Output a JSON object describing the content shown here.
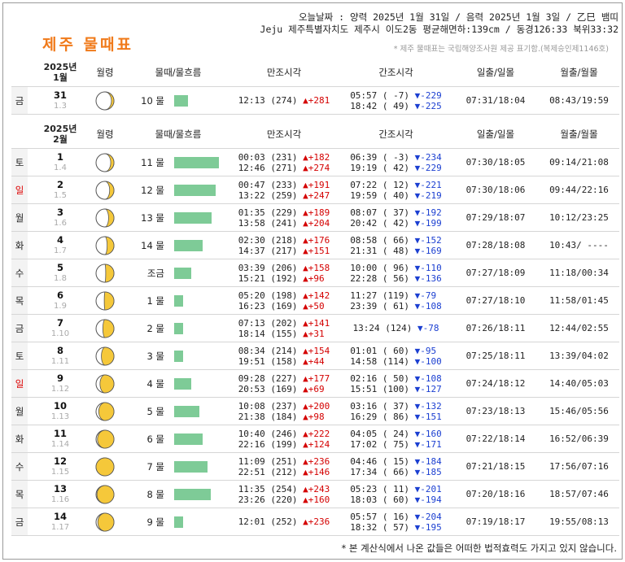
{
  "header": {
    "today_line": "오늘날짜 : 양력 2025년 1월 31일 / 음력 2025년 1월 3일 / 乙巳 뱀띠",
    "location_line": "Jeju 제주특별자치도 제주시 이도2동 평균해면하:139cm / 동경126:33 북위33:32",
    "title": "제주 물때표",
    "note": "* 제주 물때표는 국립해양조사원 제공 표기함.(복제승인제1146호)"
  },
  "columns": [
    "월령",
    "물때/물흐름",
    "만조시각",
    "간조시각",
    "일출/일몰",
    "월출/월몰"
  ],
  "jan": {
    "label_year": "2025년",
    "label_month": "1월",
    "rows": [
      {
        "wd": "금",
        "sun": false,
        "day": "31",
        "lunar": "1.3",
        "phase": 0.14,
        "mul": "10 물",
        "flow": 0.3,
        "h1": "12:13 (274)",
        "h1d": "▲+281",
        "h2": "",
        "h2d": "",
        "l1": "05:57 ( -7)",
        "l1d": "▼-229",
        "l2": "18:42 ( 49)",
        "l2d": "▼-225",
        "sun_rs": "07:31/18:04",
        "moon_rs": "08:43/19:59"
      }
    ]
  },
  "feb": {
    "label_year": "2025년",
    "label_month": "2월",
    "rows": [
      {
        "wd": "토",
        "sun": false,
        "day": "1",
        "lunar": "1.4",
        "phase": 0.18,
        "mul": "11 물",
        "flow": 1.0,
        "h1": "00:03 (231)",
        "h1d": "▲+182",
        "h2": "12:46 (271)",
        "h2d": "▲+274",
        "l1": "06:39 ( -3)",
        "l1d": "▼-234",
        "l2": "19:19 ( 42)",
        "l2d": "▼-229",
        "sun_rs": "07:30/18:05",
        "moon_rs": "09:14/21:08"
      },
      {
        "wd": "일",
        "sun": true,
        "day": "2",
        "lunar": "1.5",
        "phase": 0.24,
        "mul": "12 물",
        "flow": 0.92,
        "h1": "00:47 (233)",
        "h1d": "▲+191",
        "h2": "13:22 (259)",
        "h2d": "▲+247",
        "l1": "07:22 ( 12)",
        "l1d": "▼-221",
        "l2": "19:59 ( 40)",
        "l2d": "▼-219",
        "sun_rs": "07:30/18:06",
        "moon_rs": "09:44/22:16"
      },
      {
        "wd": "월",
        "sun": false,
        "day": "3",
        "lunar": "1.6",
        "phase": 0.3,
        "mul": "13 물",
        "flow": 0.84,
        "h1": "01:35 (229)",
        "h1d": "▲+189",
        "h2": "13:58 (241)",
        "h2d": "▲+204",
        "l1": "08:07 ( 37)",
        "l1d": "▼-192",
        "l2": "20:42 ( 42)",
        "l2d": "▼-199",
        "sun_rs": "07:29/18:07",
        "moon_rs": "10:12/23:25"
      },
      {
        "wd": "화",
        "sun": false,
        "day": "4",
        "lunar": "1.7",
        "phase": 0.38,
        "mul": "14 물",
        "flow": 0.64,
        "h1": "02:30 (218)",
        "h1d": "▲+176",
        "h2": "14:37 (217)",
        "h2d": "▲+151",
        "l1": "08:58 ( 66)",
        "l1d": "▼-152",
        "l2": "21:31 ( 48)",
        "l2d": "▼-169",
        "sun_rs": "07:28/18:08",
        "moon_rs": "10:43/ ----"
      },
      {
        "wd": "수",
        "sun": false,
        "day": "5",
        "lunar": "1.8",
        "phase": 0.46,
        "mul": "조금",
        "flow": 0.38,
        "h1": "03:39 (206)",
        "h1d": "▲+158",
        "h2": "15:21 (192)",
        "h2d": "▲+96",
        "l1": "10:00 ( 96)",
        "l1d": "▼-110",
        "l2": "22:28 ( 56)",
        "l2d": "▼-136",
        "sun_rs": "07:27/18:09",
        "moon_rs": "11:18/00:34"
      },
      {
        "wd": "목",
        "sun": false,
        "day": "6",
        "lunar": "1.9",
        "phase": 0.54,
        "mul": "1 물",
        "flow": 0.2,
        "h1": "05:20 (198)",
        "h1d": "▲+142",
        "h2": "16:23 (169)",
        "h2d": "▲+50",
        "l1": "11:27 (119)",
        "l1d": "▼-79",
        "l2": "23:39 ( 61)",
        "l2d": "▼-108",
        "sun_rs": "07:27/18:10",
        "moon_rs": "11:58/01:45"
      },
      {
        "wd": "금",
        "sun": false,
        "day": "7",
        "lunar": "1.10",
        "phase": 0.62,
        "mul": "2 물",
        "flow": 0.2,
        "h1": "07:13 (202)",
        "h1d": "▲+141",
        "h2": "18:14 (155)",
        "h2d": "▲+31",
        "l1": "13:24 (124)",
        "l1d": "▼-78",
        "l2": "",
        "l2d": "",
        "sun_rs": "07:26/18:11",
        "moon_rs": "12:44/02:55"
      },
      {
        "wd": "토",
        "sun": false,
        "day": "8",
        "lunar": "1.11",
        "phase": 0.7,
        "mul": "3 물",
        "flow": 0.2,
        "h1": "08:34 (214)",
        "h1d": "▲+154",
        "h2": "19:51 (158)",
        "h2d": "▲+44",
        "l1": "01:01 ( 60)",
        "l1d": "▼-95",
        "l2": "14:58 (114)",
        "l2d": "▼-100",
        "sun_rs": "07:25/18:11",
        "moon_rs": "13:39/04:02"
      },
      {
        "wd": "일",
        "sun": true,
        "day": "9",
        "lunar": "1.12",
        "phase": 0.78,
        "mul": "4 물",
        "flow": 0.38,
        "h1": "09:28 (227)",
        "h1d": "▲+177",
        "h2": "20:53 (169)",
        "h2d": "▲+69",
        "l1": "02:16 ( 50)",
        "l1d": "▼-108",
        "l2": "15:51 (100)",
        "l2d": "▼-127",
        "sun_rs": "07:24/18:12",
        "moon_rs": "14:40/05:03"
      },
      {
        "wd": "월",
        "sun": false,
        "day": "10",
        "lunar": "1.13",
        "phase": 0.85,
        "mul": "5 물",
        "flow": 0.56,
        "h1": "10:08 (237)",
        "h1d": "▲+200",
        "h2": "21:38 (184)",
        "h2d": "▲+98",
        "l1": "03:16 ( 37)",
        "l1d": "▼-132",
        "l2": "16:29 ( 86)",
        "l2d": "▼-151",
        "sun_rs": "07:23/18:13",
        "moon_rs": "15:46/05:56"
      },
      {
        "wd": "화",
        "sun": false,
        "day": "11",
        "lunar": "1.14",
        "phase": 0.92,
        "mul": "6 물",
        "flow": 0.64,
        "h1": "10:40 (246)",
        "h1d": "▲+222",
        "h2": "22:16 (199)",
        "h2d": "▲+124",
        "l1": "04:05 ( 24)",
        "l1d": "▼-160",
        "l2": "17:02 ( 75)",
        "l2d": "▼-171",
        "sun_rs": "07:22/18:14",
        "moon_rs": "16:52/06:39"
      },
      {
        "wd": "수",
        "sun": false,
        "day": "12",
        "lunar": "1.15",
        "phase": 1.0,
        "mul": "7 물",
        "flow": 0.74,
        "h1": "11:09 (251)",
        "h1d": "▲+236",
        "h2": "22:51 (212)",
        "h2d": "▲+146",
        "l1": "04:46 ( 15)",
        "l1d": "▼-184",
        "l2": "17:34 ( 66)",
        "l2d": "▼-185",
        "sun_rs": "07:21/18:15",
        "moon_rs": "17:56/07:16"
      },
      {
        "wd": "목",
        "sun": false,
        "day": "13",
        "lunar": "1.16",
        "phase": 0.95,
        "mul": "8 물",
        "flow": 0.82,
        "h1": "11:35 (254)",
        "h1d": "▲+243",
        "h2": "23:26 (220)",
        "h2d": "▲+160",
        "l1": "05:23 ( 11)",
        "l1d": "▼-201",
        "l2": "18:03 ( 60)",
        "l2d": "▼-194",
        "sun_rs": "07:20/18:16",
        "moon_rs": "18:57/07:46"
      },
      {
        "wd": "금",
        "sun": false,
        "day": "14",
        "lunar": "1.17",
        "phase": 0.9,
        "mul": "9 물",
        "flow": 0.2,
        "h1": "12:01 (252)",
        "h1d": "▲+236",
        "h2": "",
        "h2d": "",
        "l1": "05:57 ( 16)",
        "l1d": "▼-204",
        "l2": "18:32 ( 57)",
        "l2d": "▼-195",
        "sun_rs": "07:19/18:17",
        "moon_rs": "19:55/08:13"
      }
    ]
  },
  "footer": "* 본 계산식에서 나온 값들은 어떠한 법적효력도 가지고 있지 않습니다.",
  "colors": {
    "title": "#f07a1a",
    "flow_bar": "#7ecb97",
    "rise": "#d40000",
    "fall": "#1b3fd1",
    "moon_fill": "#f5c83a"
  }
}
